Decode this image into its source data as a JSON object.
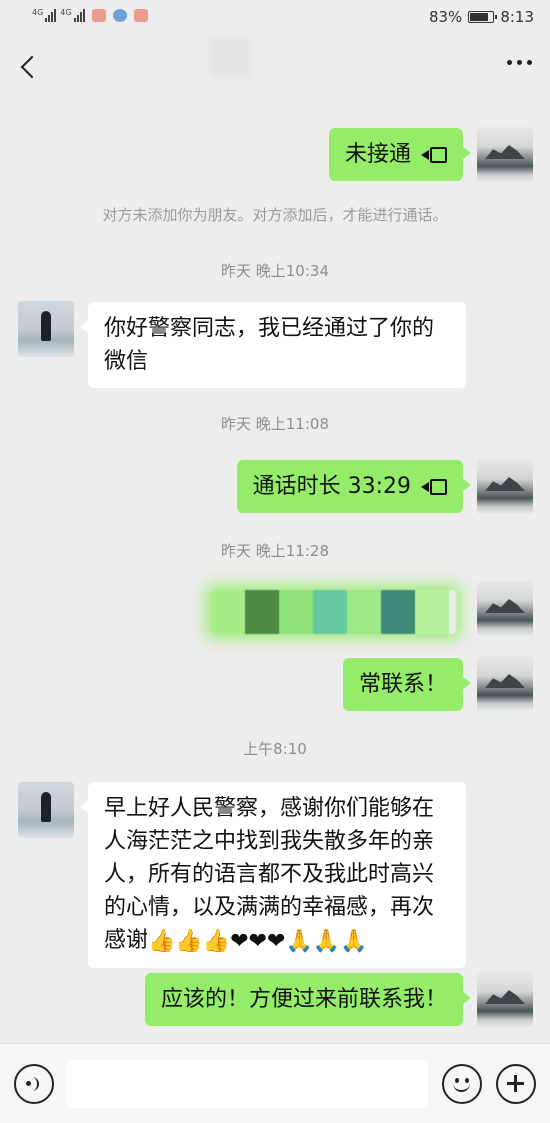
{
  "status_bar": {
    "signal1_label": "4G",
    "signal2_label": "4G",
    "battery_text": "83%",
    "battery_level": 0.83,
    "time": "8:13"
  },
  "header": {
    "back_icon": "chevron-left-icon",
    "more_icon": "more-dots-icon"
  },
  "messages": [
    {
      "type": "call",
      "side": "me",
      "text": "未接通",
      "icon": "video-call-icon"
    },
    {
      "type": "system",
      "text": "对方未添加你为朋友。对方添加后，才能进行通话。"
    },
    {
      "type": "time",
      "text": "昨天 晚上10:34"
    },
    {
      "type": "text",
      "side": "other",
      "text": "你好警察同志，我已经通过了你的微信"
    },
    {
      "type": "time",
      "text": "昨天 晚上11:08"
    },
    {
      "type": "call",
      "side": "me",
      "text": "通话时长 33:29",
      "icon": "video-call-icon"
    },
    {
      "type": "time",
      "text": "昨天 晚上11:28"
    },
    {
      "type": "sticker",
      "side": "me",
      "colors": [
        "#a6ee85",
        "#4f8a45",
        "#8fe27a",
        "#66c8a0",
        "#a0e98a",
        "#3e8a78",
        "#b6f09a"
      ]
    },
    {
      "type": "text",
      "side": "me",
      "text": "常联系！"
    },
    {
      "type": "time",
      "text": "上午8:10"
    },
    {
      "type": "text",
      "side": "other",
      "text": "早上好人民警察，感谢你们能够在人海茫茫之中找到我失散多年的亲人，所有的语言都不及我此时高兴的心情，以及满满的幸福感，再次感谢",
      "emojis": "👍👍👍❤❤❤🙏🙏🙏"
    },
    {
      "type": "text",
      "side": "me",
      "text": "应该的！方便过来前联系我！"
    }
  ],
  "input_bar": {
    "voice_icon": "voice-icon",
    "emoji_icon": "emoji-icon",
    "plus_icon": "plus-icon"
  }
}
